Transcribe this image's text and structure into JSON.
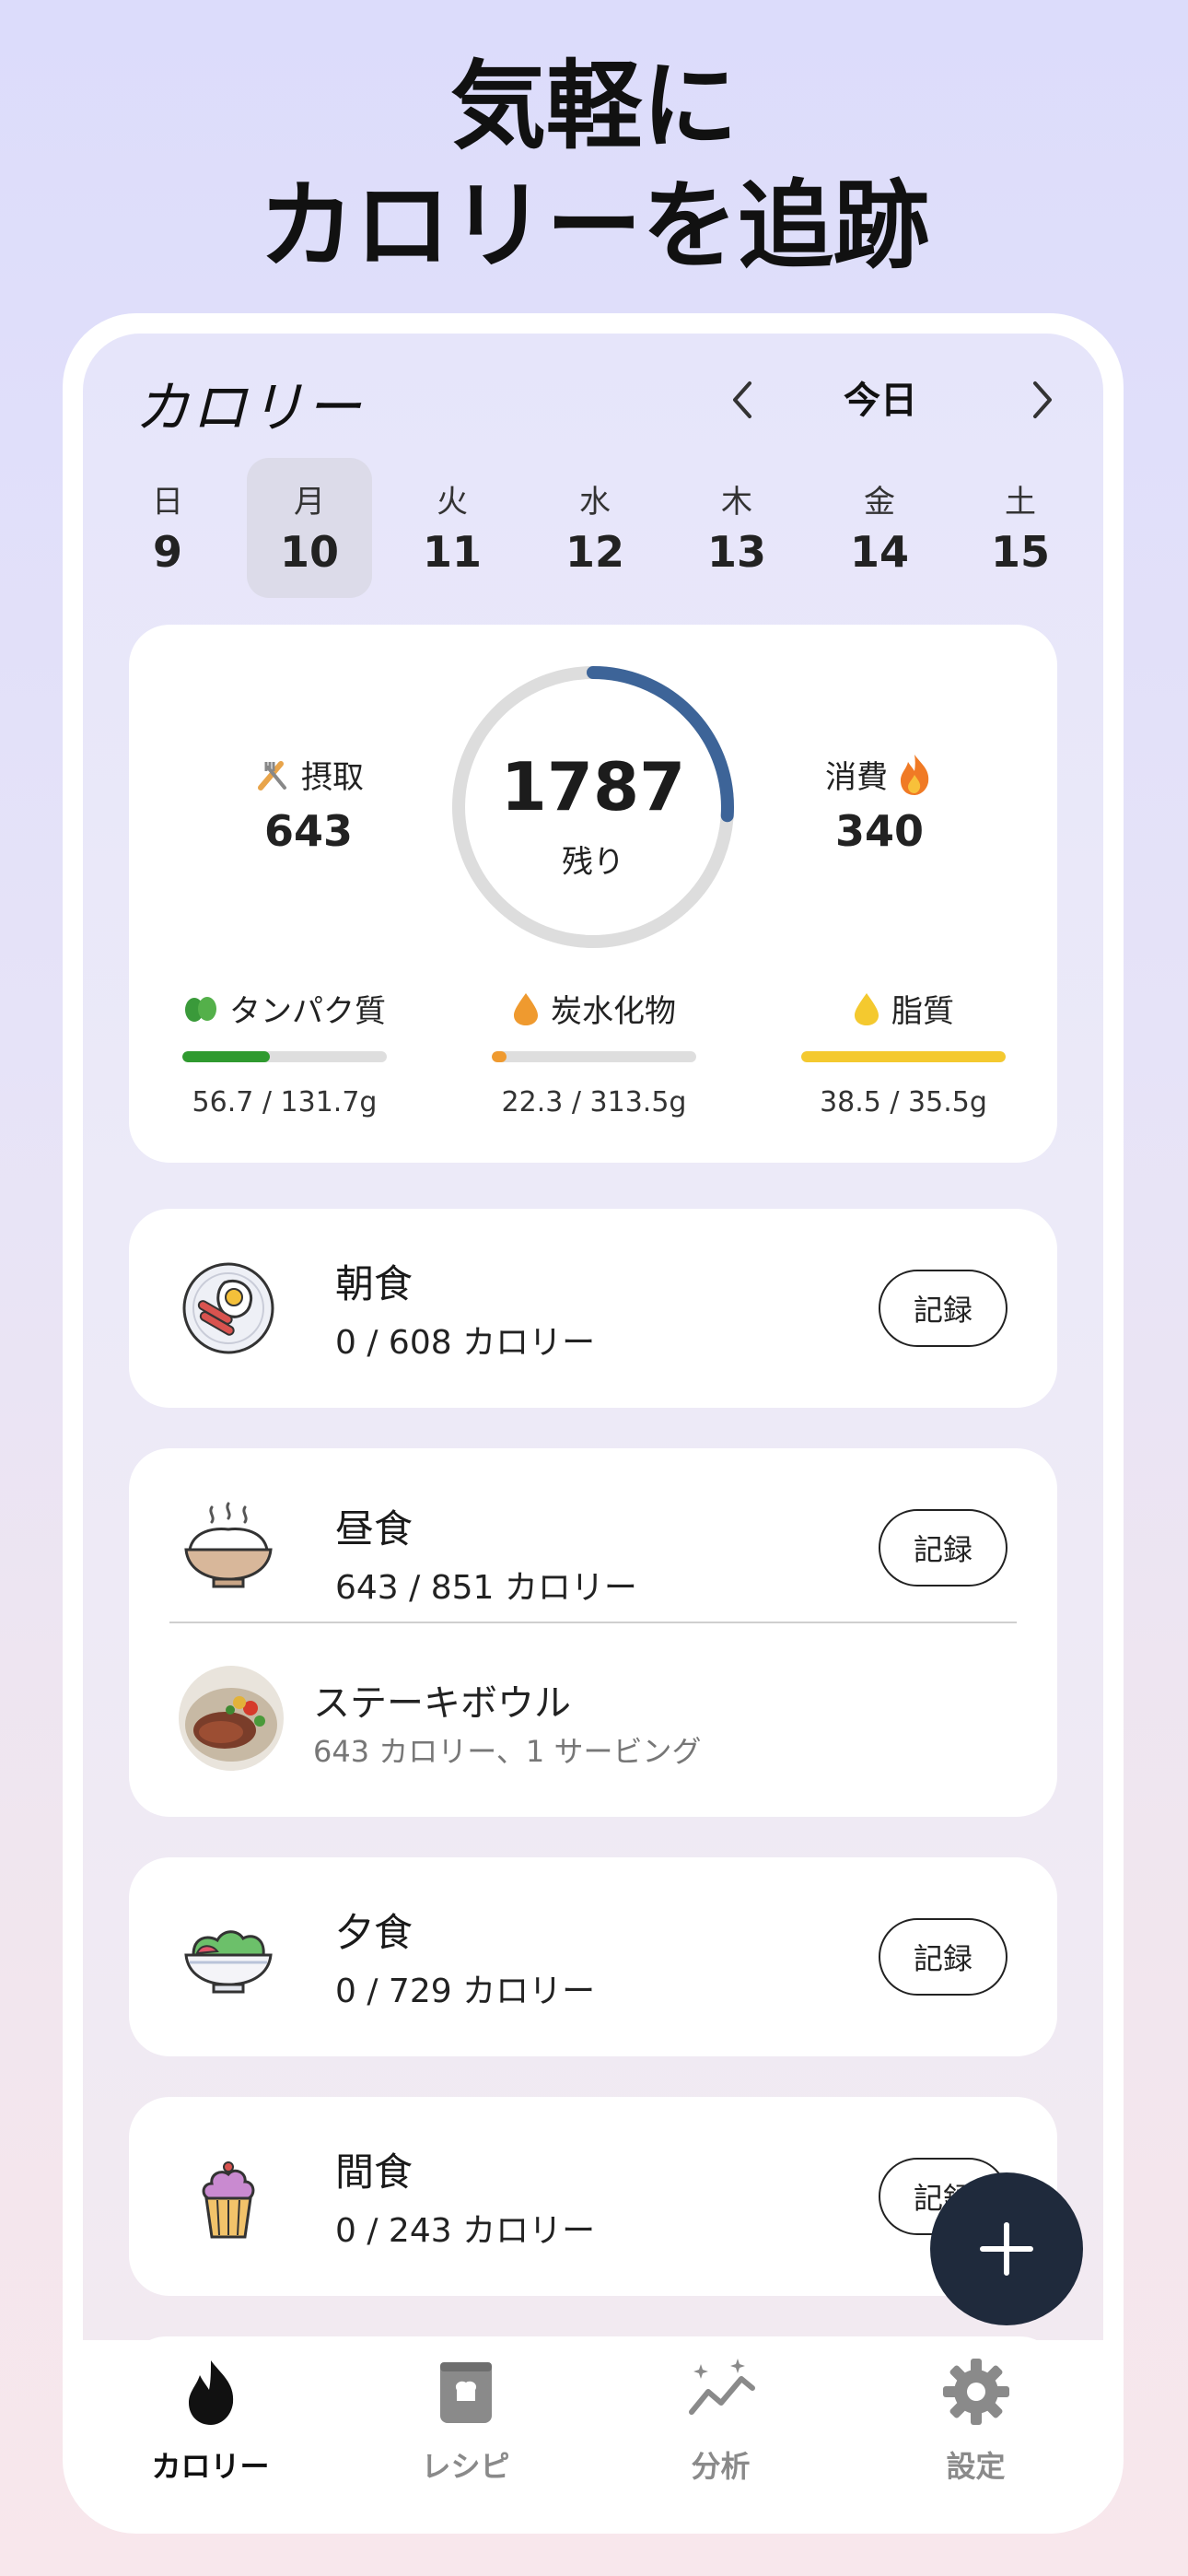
{
  "headline": {
    "line1": "気軽に",
    "line2": "カロリーを追跡"
  },
  "header": {
    "title": "カロリー",
    "date_label": "今日"
  },
  "week": [
    {
      "name": "日",
      "num": "9"
    },
    {
      "name": "月",
      "num": "10",
      "selected": true
    },
    {
      "name": "火",
      "num": "11"
    },
    {
      "name": "水",
      "num": "12"
    },
    {
      "name": "木",
      "num": "13"
    },
    {
      "name": "金",
      "num": "14"
    },
    {
      "name": "土",
      "num": "15"
    }
  ],
  "summary": {
    "intake_label": "摂取",
    "intake_value": "643",
    "remaining_value": "1787",
    "remaining_label": "残り",
    "burned_label": "消費",
    "burned_value": "340",
    "ring_progress": 0.26,
    "accent_color": "#3d6498"
  },
  "macros": [
    {
      "label": "タンパク質",
      "value": "56.7 / 131.7g",
      "progress": 0.43,
      "color": "#2f9a2f"
    },
    {
      "label": "炭水化物",
      "value": "22.3 / 313.5g",
      "progress": 0.07,
      "color": "#ef9a2f"
    },
    {
      "label": "脂質",
      "value": "38.5 / 35.5g",
      "progress": 1.0,
      "color": "#f4c92f"
    }
  ],
  "meals": [
    {
      "name": "朝食",
      "calories": "0 / 608 カロリー",
      "button": "記録"
    },
    {
      "name": "昼食",
      "calories": "643 / 851 カロリー",
      "button": "記録",
      "food": {
        "name": "ステーキボウル",
        "detail": "643 カロリー、1 サービング"
      }
    },
    {
      "name": "夕食",
      "calories": "0 / 729 カロリー",
      "button": "記録"
    },
    {
      "name": "間食",
      "calories": "0 / 243 カロリー",
      "button": "記録"
    }
  ],
  "tabs": [
    {
      "label": "カロリー",
      "icon": "flame-icon",
      "active": true
    },
    {
      "label": "レシピ",
      "icon": "recipe-book-icon"
    },
    {
      "label": "分析",
      "icon": "analytics-icon"
    },
    {
      "label": "設定",
      "icon": "gear-icon"
    }
  ]
}
